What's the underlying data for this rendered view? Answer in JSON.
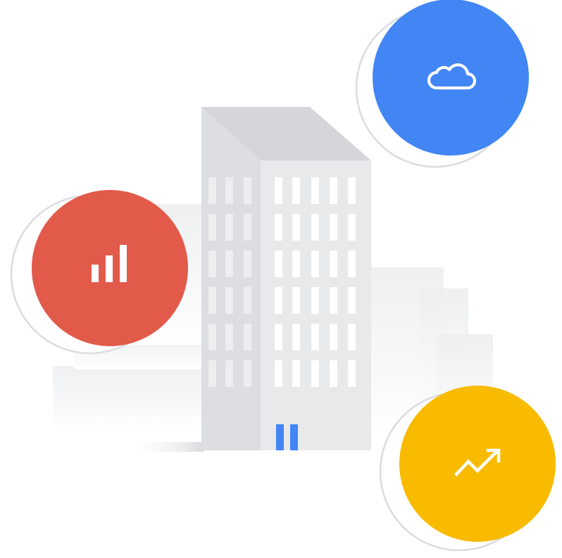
{
  "colors": {
    "background": "#ffffff",
    "building_front": "#e6e7e9",
    "building_side": "#dadce0",
    "building_roof": "#d2d4d8",
    "building_window": "#ffffff",
    "door": "#4285f4",
    "background_buildings": "#f1f3f4",
    "ground_shadow": "#e8eaed",
    "badge_outline": "#dadce0",
    "cloud_badge": "#4285f4",
    "analytics_badge": "#e25a4a",
    "trend_badge": "#f8bb00",
    "icon_stroke": "#ffffff"
  },
  "icons": {
    "cloud": "cloud-icon",
    "analytics": "bar-chart-icon",
    "trend": "trending-up-icon"
  }
}
